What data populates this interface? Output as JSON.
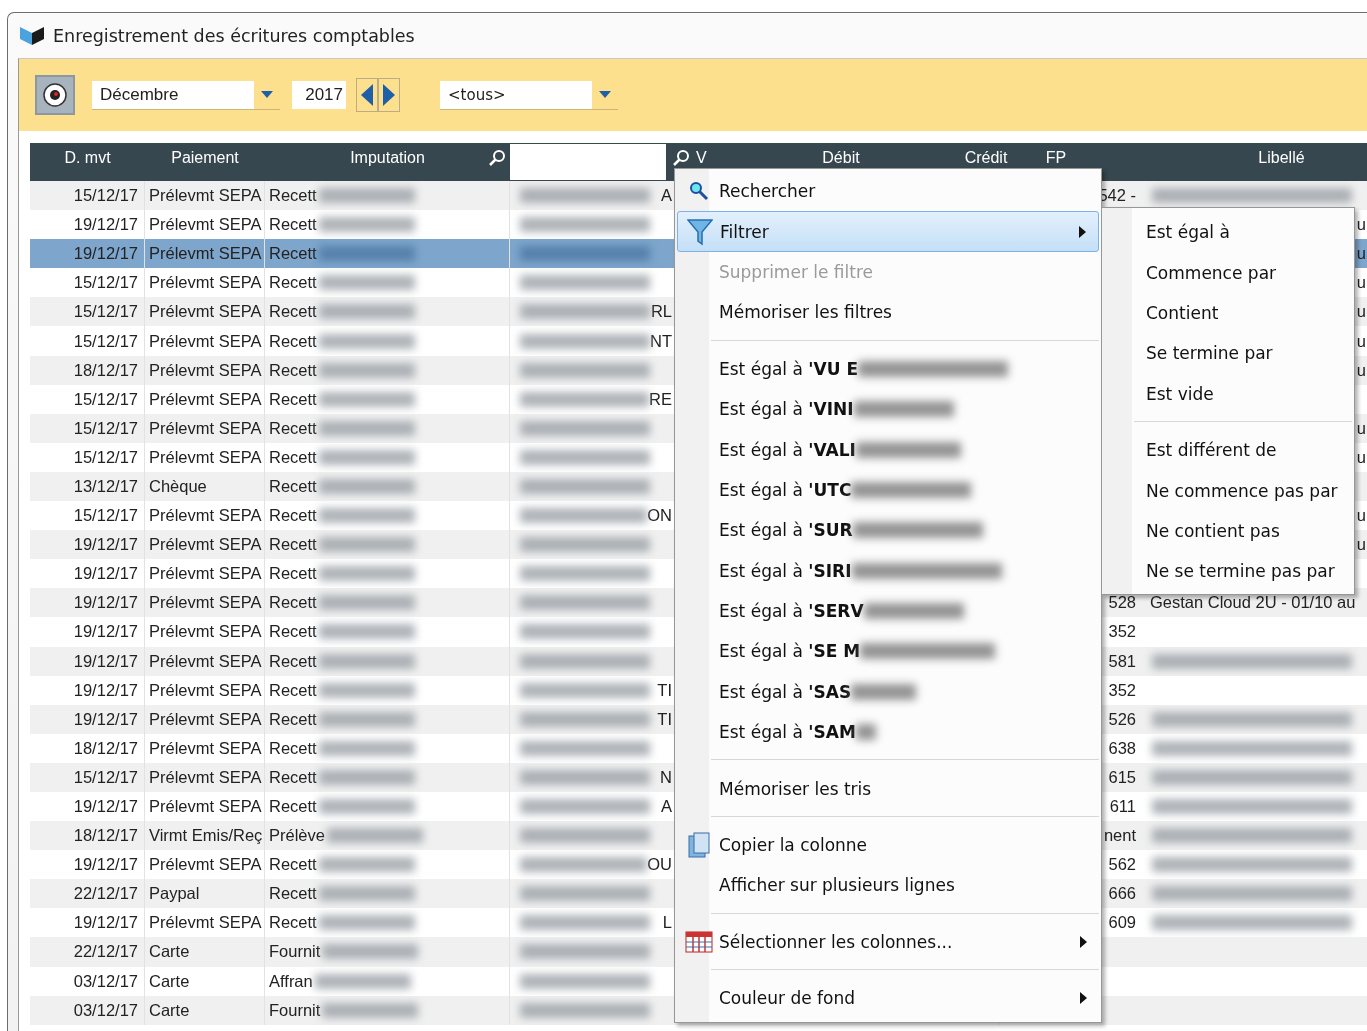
{
  "window": {
    "title": "Enregistrement des écritures comptables"
  },
  "toolbar": {
    "month": "Décembre",
    "year": "2017",
    "account_filter": "<tous>"
  },
  "table": {
    "columns": [
      "D. mvt",
      "Paiement",
      "Imputation",
      "V",
      "Débit",
      "Crédit",
      "FP",
      "Libellé"
    ],
    "rows": [
      {
        "date": "15/12/17",
        "payment": "Prélevmt SEPA",
        "imputation": "Recett",
        "column_4": "A",
        "fp": "542 -",
        "libelle": "",
        "libelle_edge": "",
        "libelle_hidden": true,
        "selected": false
      },
      {
        "date": "19/12/17",
        "payment": "Prélevmt SEPA",
        "imputation": "Recett",
        "column_4": "",
        "fp": "",
        "libelle": "",
        "libelle_edge": "u",
        "selected": false
      },
      {
        "date": "19/12/17",
        "payment": "Prélevmt SEPA",
        "imputation": "Recett",
        "column_4": "",
        "fp": "",
        "libelle": "",
        "libelle_edge": "u",
        "selected": true
      },
      {
        "date": "15/12/17",
        "payment": "Prélevmt SEPA",
        "imputation": "Recett",
        "column_4": "",
        "fp": "",
        "libelle": "",
        "libelle_edge": "u",
        "selected": false
      },
      {
        "date": "15/12/17",
        "payment": "Prélevmt SEPA",
        "imputation": "Recett",
        "column_4": "RL",
        "fp": "",
        "libelle": "",
        "libelle_edge": "u",
        "selected": false
      },
      {
        "date": "15/12/17",
        "payment": "Prélevmt SEPA",
        "imputation": "Recett",
        "column_4": "NT",
        "fp": "",
        "libelle": "",
        "libelle_edge": "u",
        "selected": false
      },
      {
        "date": "18/12/17",
        "payment": "Prélevmt SEPA",
        "imputation": "Recett",
        "column_4": "",
        "fp": "",
        "libelle": "",
        "libelle_edge": "u",
        "selected": false
      },
      {
        "date": "15/12/17",
        "payment": "Prélevmt SEPA",
        "imputation": "Recett",
        "column_4": "RE",
        "fp": "",
        "libelle": "",
        "libelle_edge": "",
        "selected": false
      },
      {
        "date": "15/12/17",
        "payment": "Prélevmt SEPA",
        "imputation": "Recett",
        "column_4": "",
        "fp": "",
        "libelle": "",
        "libelle_edge": "u",
        "selected": false
      },
      {
        "date": "15/12/17",
        "payment": "Prélevmt SEPA",
        "imputation": "Recett",
        "column_4": "",
        "fp": "",
        "libelle": "",
        "libelle_edge": "u",
        "selected": false
      },
      {
        "date": "13/12/17",
        "payment": "Chèque",
        "imputation": "Recett",
        "column_4": "",
        "fp": "",
        "libelle": "",
        "libelle_edge": "",
        "selected": false
      },
      {
        "date": "15/12/17",
        "payment": "Prélevmt SEPA",
        "imputation": "Recett",
        "column_4": "ON",
        "fp": "",
        "libelle": "",
        "libelle_edge": "u",
        "selected": false
      },
      {
        "date": "19/12/17",
        "payment": "Prélevmt SEPA",
        "imputation": "Recett",
        "column_4": "",
        "fp": "",
        "libelle": "",
        "libelle_edge": "u",
        "selected": false
      },
      {
        "date": "19/12/17",
        "payment": "Prélevmt SEPA",
        "imputation": "Recett",
        "column_4": "",
        "fp": "",
        "libelle": "",
        "libelle_edge": "",
        "selected": false
      },
      {
        "date": "19/12/17",
        "payment": "Prélevmt SEPA",
        "imputation": "Recett",
        "column_4": "",
        "fp": "528",
        "libelle": "Gestan Cloud 2U - 01/10 au",
        "libelle_edge": "",
        "selected": false
      },
      {
        "date": "19/12/17",
        "payment": "Prélevmt SEPA",
        "imputation": "Recett",
        "column_4": "",
        "fp": "352",
        "libelle": "",
        "libelle_edge": "",
        "libelle_hidden": false,
        "selected": false
      },
      {
        "date": "19/12/17",
        "payment": "Prélevmt SEPA",
        "imputation": "Recett",
        "column_4": "",
        "fp": "581",
        "libelle": "",
        "libelle_edge": "",
        "libelle_hidden": true,
        "selected": false
      },
      {
        "date": "19/12/17",
        "payment": "Prélevmt SEPA",
        "imputation": "Recett",
        "column_4": "TI",
        "fp": "352",
        "libelle": "",
        "libelle_edge": "",
        "libelle_hidden": false,
        "selected": false
      },
      {
        "date": "19/12/17",
        "payment": "Prélevmt SEPA",
        "imputation": "Recett",
        "column_4": "TI",
        "fp": "526",
        "libelle": "",
        "libelle_edge": "",
        "libelle_hidden": true,
        "selected": false
      },
      {
        "date": "18/12/17",
        "payment": "Prélevmt SEPA",
        "imputation": "Recett",
        "column_4": "",
        "fp": "638",
        "libelle": "",
        "libelle_edge": "",
        "libelle_hidden": true,
        "selected": false
      },
      {
        "date": "15/12/17",
        "payment": "Prélevmt SEPA",
        "imputation": "Recett",
        "column_4": "N",
        "fp": "615",
        "libelle": "",
        "libelle_edge": "",
        "libelle_hidden": true,
        "selected": false
      },
      {
        "date": "19/12/17",
        "payment": "Prélevmt SEPA",
        "imputation": "Recett",
        "column_4": "A",
        "fp": "611",
        "libelle": "",
        "libelle_edge": "",
        "libelle_hidden": true,
        "selected": false
      },
      {
        "date": "18/12/17",
        "payment": "Virmt Emis/Reç",
        "imputation": "Prélève",
        "column_4": "",
        "fp": "nent",
        "libelle": "",
        "libelle_edge": "",
        "libelle_hidden": true,
        "selected": false
      },
      {
        "date": "19/12/17",
        "payment": "Prélevmt SEPA",
        "imputation": "Recett",
        "column_4": "OU",
        "fp": "562",
        "libelle": "",
        "libelle_edge": "",
        "libelle_hidden": true,
        "selected": false
      },
      {
        "date": "22/12/17",
        "payment": "Paypal",
        "imputation": "Recett",
        "column_4": "",
        "fp": "666",
        "libelle": "",
        "libelle_edge": "",
        "libelle_hidden": true,
        "selected": false
      },
      {
        "date": "19/12/17",
        "payment": "Prélevmt SEPA",
        "imputation": "Recett",
        "column_4": "L",
        "fp": "609",
        "libelle": "",
        "libelle_edge": "",
        "libelle_hidden": true,
        "selected": false
      },
      {
        "date": "22/12/17",
        "payment": "Carte",
        "imputation": "Fournit",
        "column_4": "",
        "fp": "",
        "libelle": "",
        "libelle_edge": "",
        "libelle_hidden": false,
        "selected": false
      },
      {
        "date": "03/12/17",
        "payment": "Carte",
        "imputation": "Affran",
        "column_4": "",
        "fp": "",
        "libelle": "",
        "libelle_edge": "",
        "libelle_hidden": false,
        "selected": false
      },
      {
        "date": "03/12/17",
        "payment": "Carte",
        "imputation": "Fournit",
        "column_4": "",
        "fp": "",
        "libelle": "",
        "libelle_edge": "",
        "libelle_hidden": false,
        "selected": false
      }
    ]
  },
  "context_menu": {
    "items": [
      {
        "kind": "item",
        "label": "Rechercher",
        "selected": false,
        "disabled": false,
        "submenu": false,
        "redacted": false
      },
      {
        "kind": "item",
        "label": "Filtrer",
        "selected": true,
        "disabled": false,
        "submenu": true,
        "redacted": false
      },
      {
        "kind": "item",
        "label": "Supprimer le filtre",
        "selected": false,
        "disabled": true,
        "submenu": false,
        "redacted": false
      },
      {
        "kind": "item",
        "label": "Mémoriser les filtres",
        "selected": false,
        "disabled": false,
        "submenu": false,
        "redacted": false
      },
      {
        "kind": "separator"
      },
      {
        "kind": "item",
        "label": "Est égal à **'VU E**",
        "selected": false,
        "disabled": false,
        "submenu": false,
        "redacted": true
      },
      {
        "kind": "item",
        "label": "Est égal à **'VINI**",
        "selected": false,
        "disabled": false,
        "submenu": false,
        "redacted": true
      },
      {
        "kind": "item",
        "label": "Est égal à **'VALI**",
        "selected": false,
        "disabled": false,
        "submenu": false,
        "redacted": true
      },
      {
        "kind": "item",
        "label": "Est égal à **'UTC**",
        "selected": false,
        "disabled": false,
        "submenu": false,
        "redacted": true
      },
      {
        "kind": "item",
        "label": "Est égal à **'SUR**",
        "selected": false,
        "disabled": false,
        "submenu": false,
        "redacted": true
      },
      {
        "kind": "item",
        "label": "Est égal à **'SIRI**",
        "selected": false,
        "disabled": false,
        "submenu": false,
        "redacted": true
      },
      {
        "kind": "item",
        "label": "Est égal à **'SERV**",
        "selected": false,
        "disabled": false,
        "submenu": false,
        "redacted": true
      },
      {
        "kind": "item",
        "label": "Est égal à **'SE M**",
        "selected": false,
        "disabled": false,
        "submenu": false,
        "redacted": true
      },
      {
        "kind": "item",
        "label": "Est égal à **'SAS**",
        "selected": false,
        "disabled": false,
        "submenu": false,
        "redacted": true
      },
      {
        "kind": "item",
        "label": "Est égal à **'SAM**",
        "selected": false,
        "disabled": false,
        "submenu": false,
        "redacted": true
      },
      {
        "kind": "separator"
      },
      {
        "kind": "item",
        "label": "Mémoriser les tris",
        "selected": false,
        "disabled": false,
        "submenu": false,
        "redacted": false
      },
      {
        "kind": "separator"
      },
      {
        "kind": "item",
        "label": "Copier la colonne",
        "selected": false,
        "disabled": false,
        "submenu": false,
        "redacted": false
      },
      {
        "kind": "item",
        "label": "Afficher sur plusieurs lignes",
        "selected": false,
        "disabled": false,
        "submenu": false,
        "redacted": false
      },
      {
        "kind": "separator"
      },
      {
        "kind": "item",
        "label": "Sélectionner les colonnes...",
        "selected": false,
        "disabled": false,
        "submenu": true,
        "redacted": false
      },
      {
        "kind": "separator"
      },
      {
        "kind": "item",
        "label": "Couleur de fond",
        "selected": false,
        "disabled": false,
        "submenu": true,
        "redacted": false
      }
    ]
  },
  "filter_submenu": {
    "items": [
      {
        "kind": "item",
        "label": "Est égal à"
      },
      {
        "kind": "item",
        "label": "Commence par"
      },
      {
        "kind": "item",
        "label": "Contient"
      },
      {
        "kind": "item",
        "label": "Se termine par"
      },
      {
        "kind": "item",
        "label": "Est vide"
      },
      {
        "kind": "separator"
      },
      {
        "kind": "item",
        "label": "Est différent de"
      },
      {
        "kind": "item",
        "label": "Ne commence pas par"
      },
      {
        "kind": "item",
        "label": "Ne contient pas"
      },
      {
        "kind": "item",
        "label": "Ne se termine pas par"
      }
    ]
  }
}
